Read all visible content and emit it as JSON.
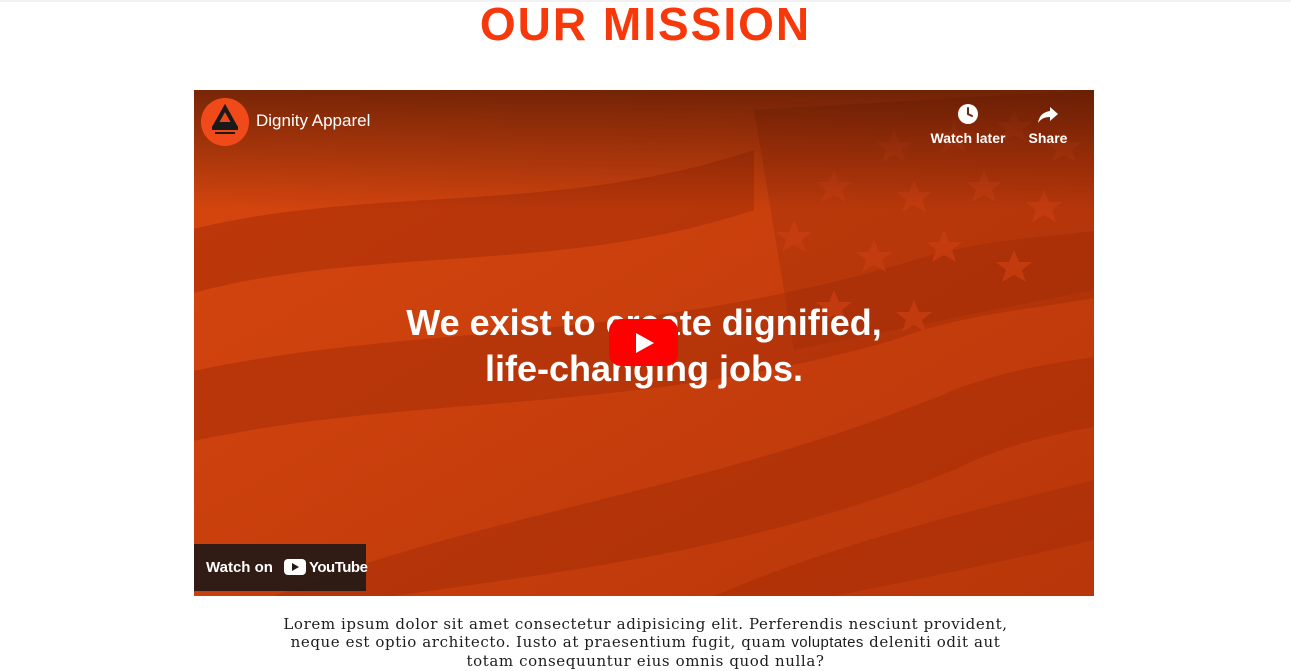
{
  "page": {
    "title": "OUR MISSION",
    "accent_color": "#f6380b"
  },
  "video": {
    "channel_name": "Dignity Apparel",
    "channel_logo_text": "DIGNITY APPAREL",
    "watch_later_label": "Watch later",
    "share_label": "Share",
    "overlay_line1": "We exist to create dignified,",
    "overlay_line2": "life-changing jobs.",
    "watch_on_label": "Watch on",
    "youtube_word": "YouTube",
    "icons": {
      "watch_later": "clock-icon",
      "share": "share-arrow-icon",
      "play": "play-icon",
      "youtube": "youtube-logo-icon"
    }
  },
  "content": {
    "paragraph_part1": "Lorem ipsum dolor sit amet consectetur adipisicing elit. Perferendis nesciunt provident, neque est optio architecto. Iusto at praesentium fugit, quam ",
    "paragraph_part2": "voluptates",
    "paragraph_part3": " deleniti odit aut totam consequuntur eius omnis quod nulla?"
  }
}
